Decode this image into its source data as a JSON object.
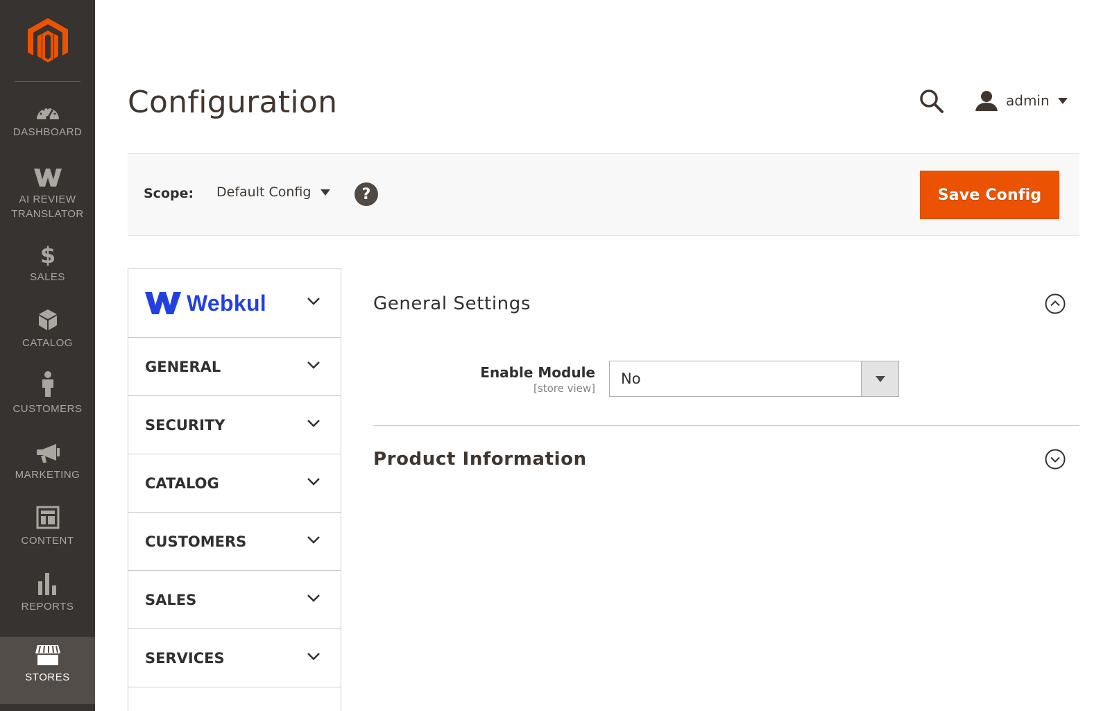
{
  "menu": {
    "items": [
      {
        "label": "DASHBOARD",
        "icon": "dashboard-icon"
      },
      {
        "label": "AI REVIEW TRANSLATOR",
        "icon": "webkul-w-icon"
      },
      {
        "label": "SALES",
        "icon": "dollar-icon"
      },
      {
        "label": "CATALOG",
        "icon": "box-icon"
      },
      {
        "label": "CUSTOMERS",
        "icon": "person-icon"
      },
      {
        "label": "MARKETING",
        "icon": "megaphone-icon"
      },
      {
        "label": "CONTENT",
        "icon": "layout-icon"
      },
      {
        "label": "REPORTS",
        "icon": "bar-chart-icon"
      },
      {
        "label": "STORES",
        "icon": "store-icon"
      }
    ],
    "active": "STORES"
  },
  "header": {
    "title": "Configuration",
    "user": "admin"
  },
  "scope": {
    "label": "Scope:",
    "value": "Default Config",
    "help": "?"
  },
  "actions": {
    "save_label": "Save Config"
  },
  "tabs": {
    "vendor": "Webkul",
    "items": [
      "GENERAL",
      "SECURITY",
      "CATALOG",
      "CUSTOMERS",
      "SALES",
      "SERVICES"
    ]
  },
  "sections": {
    "general": {
      "title": "General Settings",
      "state": "expanded",
      "fields": [
        {
          "label": "Enable Module",
          "scope": "[store view]",
          "value": "No"
        }
      ]
    },
    "product": {
      "title": "Product Information",
      "state": "collapsed"
    }
  },
  "colors": {
    "menu_bg": "#373330",
    "menu_active_bg": "#524d49",
    "accent": "#eb5202",
    "vendor_blue": "#2341e0"
  }
}
